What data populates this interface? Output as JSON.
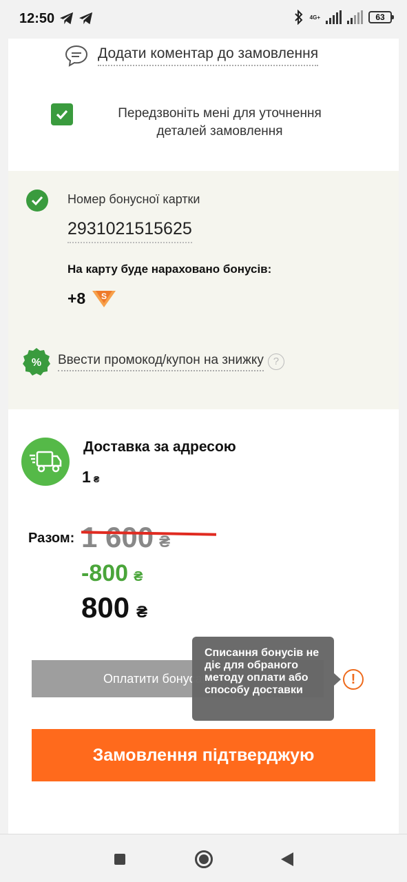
{
  "status_bar": {
    "time": "12:50",
    "network": "4G+",
    "battery": "63",
    "icons": [
      "telegram-icon",
      "telegram-icon",
      "bluetooth-icon",
      "signal-icon",
      "battery-icon"
    ]
  },
  "order": {
    "comment_link": "Додати коментар до замовлення",
    "call_me_label": "Передзвоніть мені для уточнення деталей замовлення",
    "call_me_checked": true
  },
  "bonus": {
    "card_label": "Номер бонусної картки",
    "card_number": "2931021515625",
    "accrual_label": "На карту буде нараховано бонусів:",
    "accrual_value": "+8",
    "promo_link": "Ввести промокод/купон на знижку",
    "promo_icon_text": "%",
    "help_text": "?"
  },
  "delivery": {
    "title": "Доставка за адресою",
    "price": "1",
    "currency": "₴"
  },
  "totals": {
    "label": "Разом:",
    "old_price": "1 600",
    "discount": "-800",
    "final_price": "800",
    "currency": "₴"
  },
  "actions": {
    "pay_bonus_label": "Оплатити бонусами",
    "warning_text": "!",
    "tooltip_text": "Списання бонусів не діє для обраного методу оплати або способу доставки",
    "confirm_label": "Замовлення підтверджую"
  },
  "colors": {
    "accent_orange": "#ff6a1c",
    "success_green": "#3a9b3e",
    "discount_green": "#4aa53a",
    "strike_red": "#e02a20",
    "panel_bg": "#f5f5ee"
  }
}
